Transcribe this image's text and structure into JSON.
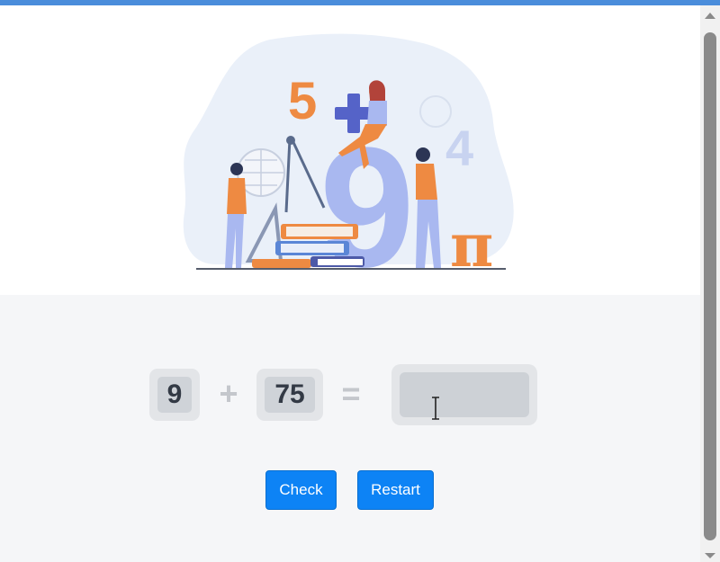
{
  "hero": {
    "illustration": "math-people-illustration",
    "glyphs": {
      "five": "5",
      "four": "4",
      "nine": "9",
      "pi": "π",
      "plus": "+"
    }
  },
  "quiz": {
    "operand_a": "9",
    "operator": "+",
    "operand_b": "75",
    "equals": "=",
    "answer_value": "",
    "answer_placeholder": ""
  },
  "buttons": {
    "check_label": "Check",
    "restart_label": "Restart"
  },
  "colors": {
    "accent": "#0d83f5",
    "top_bar": "#4a8ddb",
    "blob": "#eaf0f9",
    "orange": "#ee8a42",
    "periwinkle": "#a9b8f0",
    "indigo": "#5563c8"
  }
}
